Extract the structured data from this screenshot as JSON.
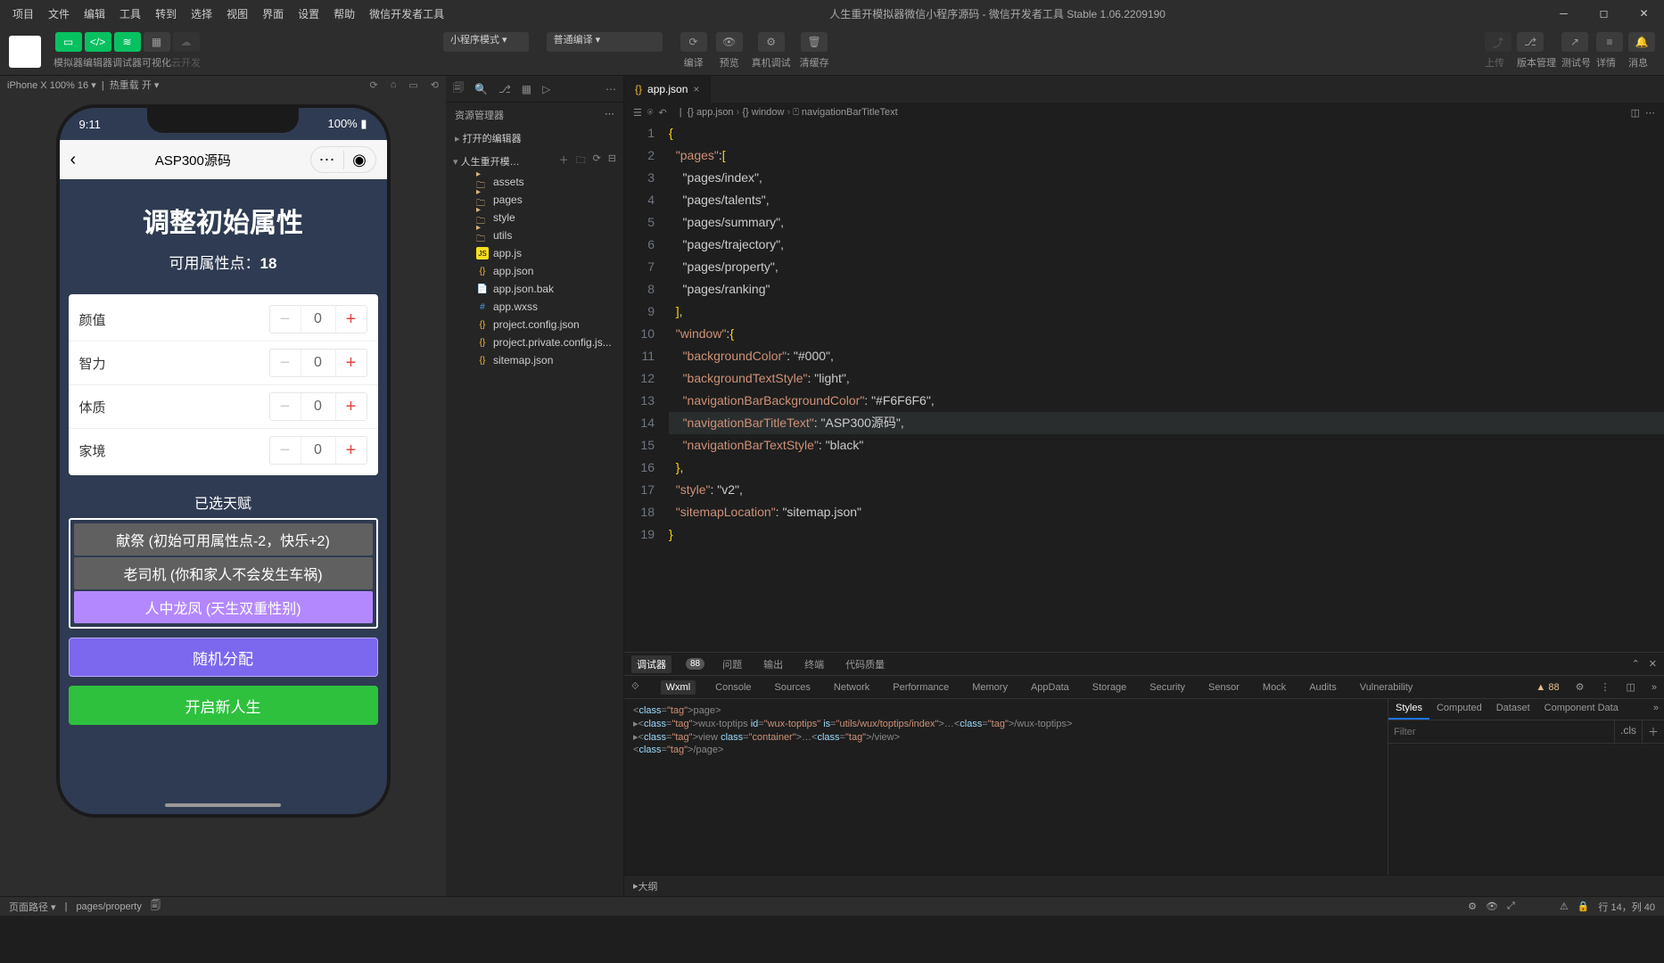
{
  "app": {
    "title": "人生重开模拟器微信小程序源码 - 微信开发者工具 Stable 1.06.2209190"
  },
  "menu": [
    "项目",
    "文件",
    "编辑",
    "工具",
    "转到",
    "选择",
    "视图",
    "界面",
    "设置",
    "帮助",
    "微信开发者工具"
  ],
  "toolbar": {
    "groups": {
      "sim": "模拟器",
      "editor": "编辑器",
      "debugger": "调试器",
      "visual": "可视化",
      "cloud": "云开发"
    },
    "mode_select": "小程序模式",
    "compile_select": "普通编译",
    "labels": {
      "compile": "编译",
      "preview": "预览",
      "realdbg": "真机调试",
      "clear": "清缓存",
      "upload": "上传",
      "version": "版本管理",
      "testid": "测试号",
      "detail": "详情",
      "msg": "消息"
    }
  },
  "subbar": {
    "device": "iPhone X 100% 16",
    "hot": "热重载 开",
    "sim_icons": true
  },
  "explorer": {
    "title": "资源管理器",
    "open_editors": "打开的编辑器",
    "project": "人生重开模…",
    "tree": [
      {
        "icon": "folder",
        "label": "assets"
      },
      {
        "icon": "folder",
        "label": "pages"
      },
      {
        "icon": "folder",
        "label": "style"
      },
      {
        "icon": "folder",
        "label": "utils"
      },
      {
        "icon": "js",
        "label": "app.js"
      },
      {
        "icon": "json",
        "label": "app.json"
      },
      {
        "icon": "file",
        "label": "app.json.bak"
      },
      {
        "icon": "css",
        "label": "app.wxss"
      },
      {
        "icon": "json",
        "label": "project.config.json"
      },
      {
        "icon": "json",
        "label": "project.private.config.js..."
      },
      {
        "icon": "json",
        "label": "sitemap.json"
      }
    ],
    "outline": "大纲"
  },
  "tab": {
    "icon": "{}",
    "label": "app.json"
  },
  "breadcrumb": [
    "{}  app.json",
    "{}  window",
    "⍞  navigationBarTitleText"
  ],
  "code": {
    "lines": [
      {
        "n": 1,
        "t": "{"
      },
      {
        "n": 2,
        "t": "  \"pages\":["
      },
      {
        "n": 3,
        "t": "    \"pages/index\","
      },
      {
        "n": 4,
        "t": "    \"pages/talents\","
      },
      {
        "n": 5,
        "t": "    \"pages/summary\","
      },
      {
        "n": 6,
        "t": "    \"pages/trajectory\","
      },
      {
        "n": 7,
        "t": "    \"pages/property\","
      },
      {
        "n": 8,
        "t": "    \"pages/ranking\""
      },
      {
        "n": 9,
        "t": "  ],"
      },
      {
        "n": 10,
        "t": "  \"window\":{"
      },
      {
        "n": 11,
        "t": "    \"backgroundColor\": \"#000\","
      },
      {
        "n": 12,
        "t": "    \"backgroundTextStyle\": \"light\","
      },
      {
        "n": 13,
        "t": "    \"navigationBarBackgroundColor\": \"#F6F6F6\","
      },
      {
        "n": 14,
        "t": "    \"navigationBarTitleText\": \"ASP300源码\",",
        "hl": true
      },
      {
        "n": 15,
        "t": "    \"navigationBarTextStyle\": \"black\""
      },
      {
        "n": 16,
        "t": "  },"
      },
      {
        "n": 17,
        "t": "  \"style\": \"v2\","
      },
      {
        "n": 18,
        "t": "  \"sitemapLocation\": \"sitemap.json\""
      },
      {
        "n": 19,
        "t": "}"
      }
    ]
  },
  "devtools": {
    "tabs1": [
      "调试器",
      "问题",
      "输出",
      "终端",
      "代码质量"
    ],
    "badge": "88",
    "tabs2": [
      "Wxml",
      "Console",
      "Sources",
      "Network",
      "Performance",
      "Memory",
      "AppData",
      "Storage",
      "Security",
      "Sensor",
      "Mock",
      "Audits",
      "Vulnerability"
    ],
    "warn": "▲ 88",
    "dom": [
      "<page>",
      " ▸<wux-toptips id=\"wux-toptips\" is=\"utils/wux/toptips/index\">…</wux-toptips>",
      " ▸<view class=\"container\">…</view>",
      "</page>"
    ],
    "styles_tabs": [
      "Styles",
      "Computed",
      "Dataset",
      "Component Data"
    ],
    "filter_placeholder": "Filter",
    "cls": ".cls"
  },
  "phone": {
    "time": "9:11",
    "battery": "100%",
    "nav_title": "ASP300源码",
    "h1": "调整初始属性",
    "h2_prefix": "可用属性点：",
    "h2_value": "18",
    "attrs": [
      {
        "name": "颜值",
        "val": "0"
      },
      {
        "name": "智力",
        "val": "0"
      },
      {
        "name": "体质",
        "val": "0"
      },
      {
        "name": "家境",
        "val": "0"
      }
    ],
    "talent_title": "已选天赋",
    "talents": [
      {
        "text": "献祭 (初始可用属性点-2，快乐+2)",
        "cls": "t-grey"
      },
      {
        "text": "老司机 (你和家人不会发生车祸)",
        "cls": "t-grey"
      },
      {
        "text": "人中龙凤 (天生双重性别)",
        "cls": "t-purple"
      }
    ],
    "btn_random": "随机分配",
    "btn_start": "开启新人生"
  },
  "status": {
    "path_label": "页面路径",
    "path": "pages/property",
    "cursor": "行 14，列 40"
  }
}
